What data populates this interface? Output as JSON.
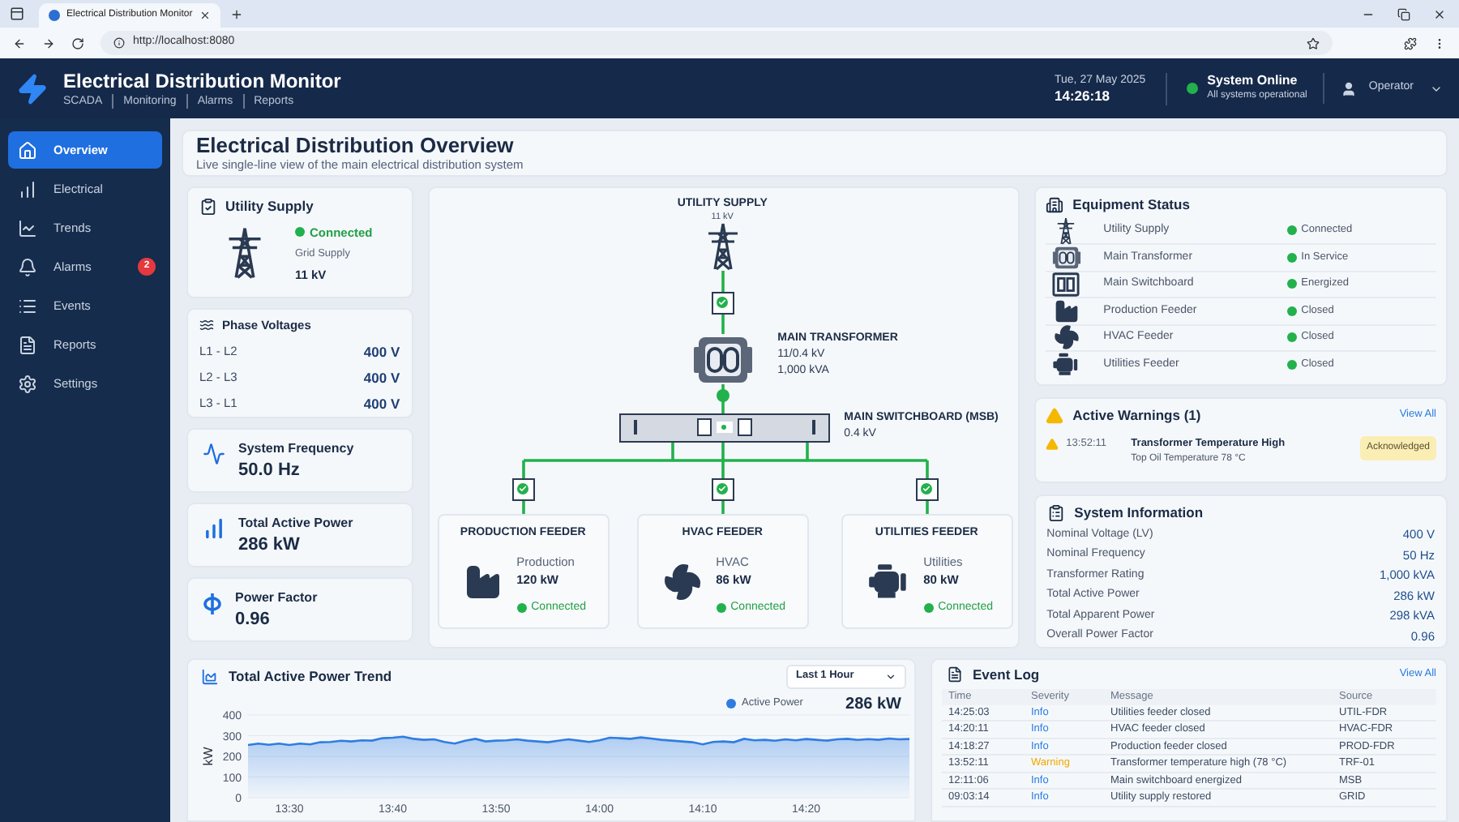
{
  "browser": {
    "tab_title": "Electrical Distribution Monitor",
    "url": "http://localhost:8080"
  },
  "header": {
    "title": "Electrical Distribution Monitor",
    "subnav": [
      "SCADA",
      "Monitoring",
      "Alarms",
      "Reports"
    ],
    "date": "Tue, 27 May 2025",
    "time": "14:26:18",
    "status": {
      "title": "System Online",
      "subtitle": "All systems operational",
      "online": true
    },
    "user": "Operator"
  },
  "sidebar": {
    "items": [
      {
        "kind": "overview",
        "label": "Overview",
        "selected": true
      },
      {
        "kind": "electrical",
        "label": "Electrical",
        "selected": false
      },
      {
        "kind": "trends",
        "label": "Trends",
        "selected": false
      },
      {
        "kind": "alarms",
        "label": "Alarms",
        "selected": false,
        "badge": "2"
      },
      {
        "kind": "events",
        "label": "Events",
        "selected": false
      },
      {
        "kind": "reports",
        "label": "Reports",
        "selected": false
      },
      {
        "kind": "settings",
        "label": "Settings",
        "selected": false
      }
    ]
  },
  "page": {
    "title": "Electrical Distribution Overview",
    "subtitle": "Live single-line view of the main electrical distribution system"
  },
  "utility_supply": {
    "title": "Utility Supply",
    "status": "Connected",
    "connected": true,
    "source": "Grid Supply",
    "voltage": "11 kV"
  },
  "phase_voltages": {
    "title": "Phase Voltages",
    "rows": [
      {
        "label": "L1 - L2",
        "value": "400 V"
      },
      {
        "label": "L2 - L3",
        "value": "400 V"
      },
      {
        "label": "L3 - L1",
        "value": "400 V"
      }
    ]
  },
  "metrics": [
    {
      "kind": "frequency",
      "label": "System Frequency",
      "value": "50.0 Hz"
    },
    {
      "kind": "power",
      "label": "Total Active Power",
      "value": "286 kW"
    },
    {
      "kind": "power_factor",
      "label": "Power Factor",
      "value": "0.96"
    }
  ],
  "diagram": {
    "supply": {
      "title": "UTILITY SUPPLY",
      "voltage": "11 kV",
      "breaker_closed": true
    },
    "transformer": {
      "title": "MAIN TRANSFORMER",
      "ratio": "11/0.4 kV",
      "rating": "1,000 kVA"
    },
    "switchboard": {
      "title": "MAIN SWITCHBOARD (MSB)",
      "voltage": "0.4 kV"
    },
    "feeders": [
      {
        "kind": "factory",
        "title": "PRODUCTION FEEDER",
        "name": "Production",
        "power": "120 kW",
        "status": "Connected",
        "connected": true,
        "breaker_closed": true
      },
      {
        "kind": "fan",
        "title": "HVAC FEEDER",
        "name": "HVAC",
        "power": "86 kW",
        "status": "Connected",
        "connected": true,
        "breaker_closed": true
      },
      {
        "kind": "motor",
        "title": "UTILITIES FEEDER",
        "name": "Utilities",
        "power": "80 kW",
        "status": "Connected",
        "connected": true,
        "breaker_closed": true
      }
    ]
  },
  "equipment_status": {
    "title": "Equipment Status",
    "items": [
      {
        "kind": "tower",
        "name": "Utility Supply",
        "status": "Connected",
        "ok": true
      },
      {
        "kind": "transformer",
        "name": "Main Transformer",
        "status": "In Service",
        "ok": true
      },
      {
        "kind": "switchboard",
        "name": "Main Switchboard",
        "status": "Energized",
        "ok": true
      },
      {
        "kind": "factory",
        "name": "Production Feeder",
        "status": "Closed",
        "ok": true
      },
      {
        "kind": "fan",
        "name": "HVAC Feeder",
        "status": "Closed",
        "ok": true
      },
      {
        "kind": "motor",
        "name": "Utilities Feeder",
        "status": "Closed",
        "ok": true
      }
    ]
  },
  "active_warnings": {
    "title": "Active Warnings (1)",
    "link": "View All",
    "items": [
      {
        "time": "13:52:11",
        "title": "Transformer Temperature High",
        "detail": "Top Oil Temperature 78 °C",
        "badge": "Acknowledged"
      }
    ]
  },
  "system_information": {
    "title": "System Information",
    "rows": [
      {
        "label": "Nominal Voltage (LV)",
        "value": "400 V"
      },
      {
        "label": "Nominal Frequency",
        "value": "50 Hz"
      },
      {
        "label": "Transformer Rating",
        "value": "1,000 kVA"
      },
      {
        "label": "Total Active Power",
        "value": "286 kW"
      },
      {
        "label": "Total Apparent Power",
        "value": "298 kVA"
      },
      {
        "label": "Overall Power Factor",
        "value": "0.96"
      }
    ]
  },
  "trend": {
    "title": "Total Active Power Trend",
    "range": "Last 1 Hour",
    "current": "286 kW",
    "chart_data": {
      "type": "area",
      "ylabel": "kW",
      "grid": true,
      "x": [
        806,
        807,
        808,
        809,
        810,
        811,
        812,
        813,
        814,
        815,
        816,
        817,
        818,
        819,
        820,
        821,
        822,
        823,
        824,
        825,
        826,
        827,
        828,
        829,
        830,
        831,
        832,
        833,
        834,
        835,
        836,
        837,
        838,
        839,
        840,
        841,
        842,
        843,
        844,
        845,
        846,
        847,
        848,
        849,
        850,
        851,
        852,
        853,
        854,
        855,
        856,
        857,
        858,
        859,
        860,
        861,
        862,
        863,
        864,
        865,
        866,
        867,
        868,
        869,
        870
      ],
      "xlim": [
        806,
        870
      ],
      "ylim": [
        0,
        400
      ],
      "yticks": [
        0,
        100,
        200,
        300,
        400
      ],
      "xticks": [
        {
          "value": 810,
          "label": "13:30"
        },
        {
          "value": 820,
          "label": "13:40"
        },
        {
          "value": 830,
          "label": "13:50"
        },
        {
          "value": 840,
          "label": "14:00"
        },
        {
          "value": 850,
          "label": "14:10"
        },
        {
          "value": 860,
          "label": "14:20"
        }
      ],
      "series": [
        {
          "name": "Active Power",
          "color": "#2f7de1",
          "values": [
            255,
            262,
            256,
            262,
            255,
            262,
            258,
            268,
            270,
            275,
            272,
            278,
            276,
            288,
            290,
            295,
            285,
            280,
            282,
            270,
            262,
            275,
            285,
            272,
            276,
            278,
            282,
            276,
            272,
            268,
            275,
            282,
            276,
            270,
            278,
            290,
            288,
            285,
            292,
            286,
            280,
            276,
            272,
            268,
            258,
            270,
            272,
            268,
            285,
            278,
            280,
            275,
            282,
            278,
            284,
            280,
            276,
            282,
            285,
            279,
            283,
            280,
            286,
            282,
            284
          ]
        }
      ]
    }
  },
  "event_log": {
    "title": "Event Log",
    "link": "View All",
    "columns": [
      "Time",
      "Severity",
      "Message",
      "Source"
    ],
    "rows": [
      {
        "time": "14:25:03",
        "kind": "info",
        "severity": "Info",
        "message": "Utilities feeder closed",
        "source": "UTIL-FDR"
      },
      {
        "time": "14:20:11",
        "kind": "info",
        "severity": "Info",
        "message": "HVAC feeder closed",
        "source": "HVAC-FDR"
      },
      {
        "time": "14:18:27",
        "kind": "info",
        "severity": "Info",
        "message": "Production feeder closed",
        "source": "PROD-FDR"
      },
      {
        "time": "13:52:11",
        "kind": "warning",
        "severity": "Warning",
        "message": "Transformer temperature high (78 °C)",
        "source": "TRF-01"
      },
      {
        "time": "12:11:06",
        "kind": "info",
        "severity": "Info",
        "message": "Main switchboard energized",
        "source": "MSB"
      },
      {
        "time": "09:03:14",
        "kind": "info",
        "severity": "Info",
        "message": "Utility supply restored",
        "source": "GRID"
      }
    ]
  }
}
